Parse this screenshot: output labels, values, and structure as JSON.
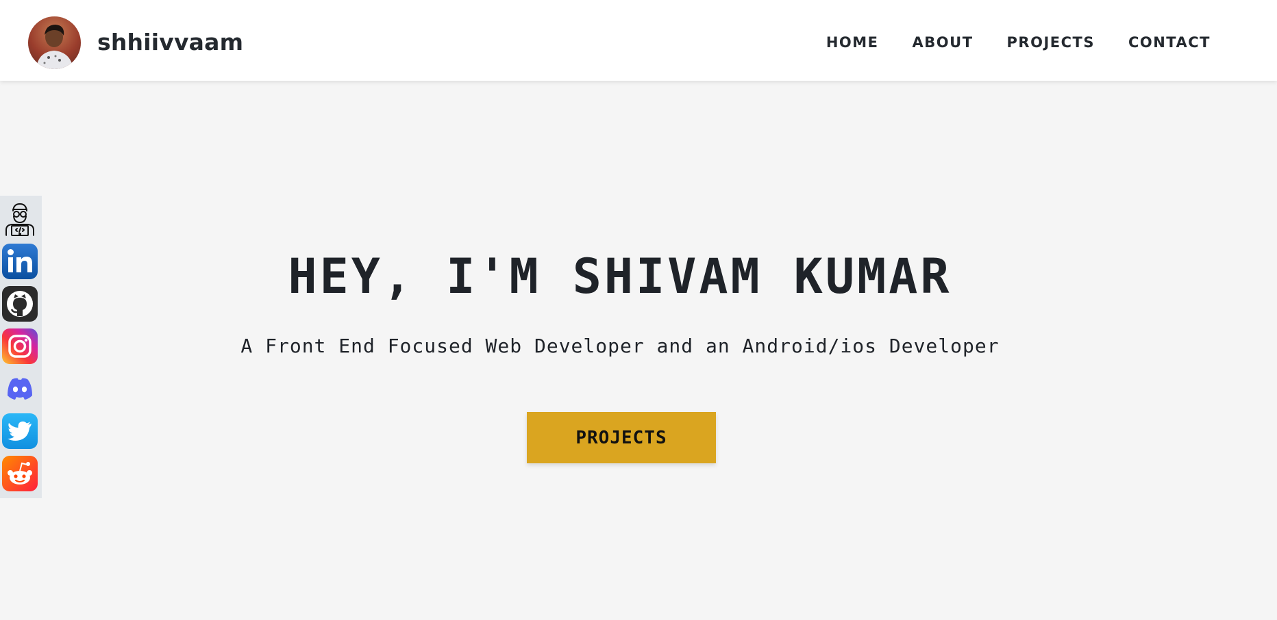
{
  "header": {
    "brand": "shhiivvaam",
    "nav": [
      "HOME",
      "ABOUT",
      "PROJECTS",
      "CONTACT"
    ]
  },
  "hero": {
    "title": "HEY, I'M SHIVAM KUMAR",
    "subtitle": "A Front End Focused Web Developer and an Android/ios Developer",
    "button_label": "PROJECTS"
  },
  "social_links": [
    {
      "name": "developer",
      "icon": "developer-icon"
    },
    {
      "name": "linkedin",
      "icon": "linkedin-icon",
      "color": "#0a66c2"
    },
    {
      "name": "github",
      "icon": "github-icon",
      "color": "#24292f"
    },
    {
      "name": "instagram",
      "icon": "instagram-icon",
      "color": "#e1306c"
    },
    {
      "name": "discord",
      "icon": "discord-icon",
      "color": "#5865f2"
    },
    {
      "name": "twitter",
      "icon": "twitter-icon",
      "color": "#1da1f2"
    },
    {
      "name": "reddit",
      "icon": "reddit-icon",
      "color": "#ff4500"
    }
  ],
  "colors": {
    "accent": "#daa520",
    "background": "#f5f5f5",
    "header": "#ffffff",
    "text": "#1f2329"
  }
}
